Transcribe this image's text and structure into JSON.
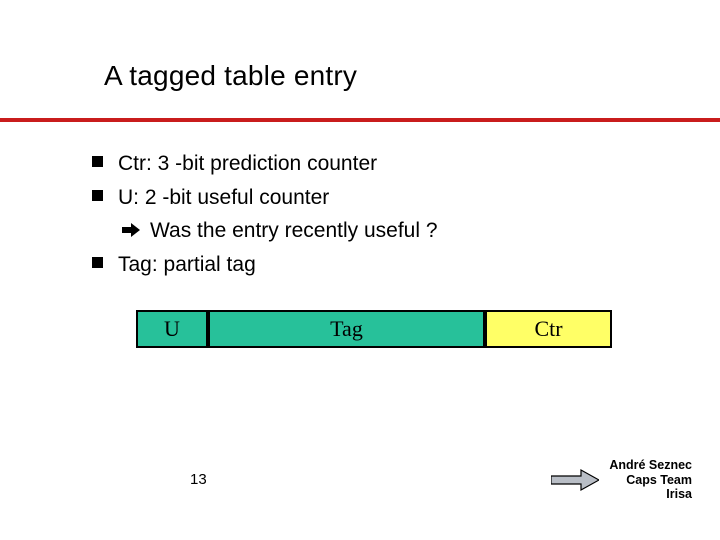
{
  "title": "A tagged table entry",
  "bullets": {
    "b1": "Ctr: 3 -bit prediction counter",
    "b2": "U: 2 -bit useful counter",
    "b2_sub": "Was the entry recently useful ?",
    "b3": "Tag: partial tag"
  },
  "diagram": {
    "u": "U",
    "tag": "Tag",
    "ctr": "Ctr"
  },
  "page_number": "13",
  "footer": {
    "line1": "André Seznec",
    "line2": "Caps Team",
    "line3": "Irisa"
  },
  "colors": {
    "rule": "#c91c1c",
    "teal": "#27c19a",
    "yellow": "#ffff66",
    "arrow_fill": "#9aa0a6",
    "arrow_stroke": "#000000"
  }
}
